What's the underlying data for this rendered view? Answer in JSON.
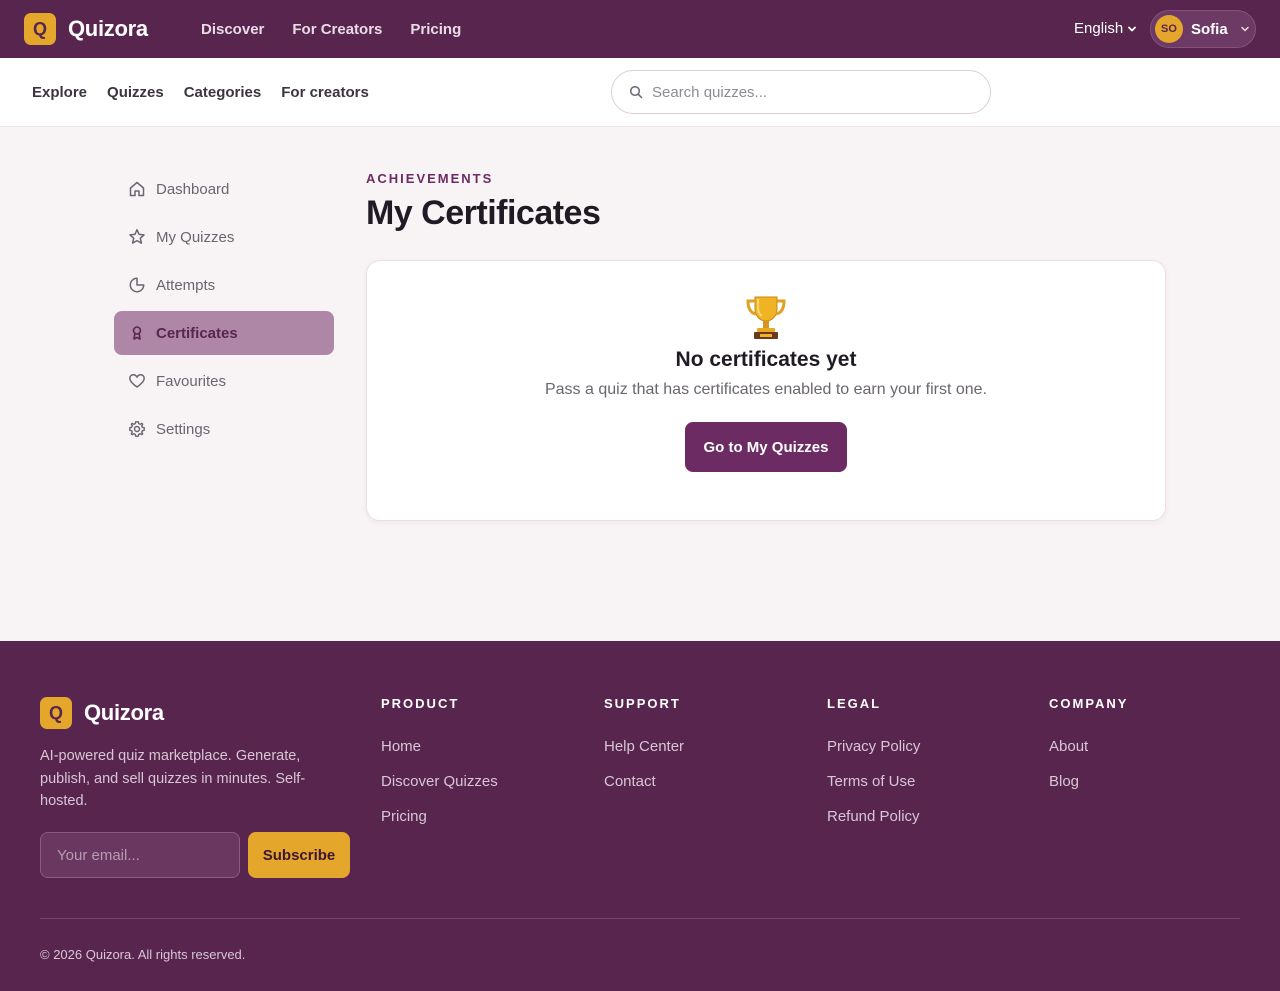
{
  "brand": {
    "logo_letter": "Q",
    "name": "Quizora"
  },
  "topnav": {
    "items": [
      "Discover",
      "For Creators",
      "Pricing"
    ]
  },
  "language": {
    "label": "English"
  },
  "user": {
    "initials": "SO",
    "name": "Sofia"
  },
  "subnav": {
    "items": [
      "Explore",
      "Quizzes",
      "Categories",
      "For creators"
    ]
  },
  "search": {
    "placeholder": "Search quizzes..."
  },
  "sidebar": {
    "items": [
      {
        "label": "Dashboard",
        "icon": "home-icon"
      },
      {
        "label": "My Quizzes",
        "icon": "star-icon"
      },
      {
        "label": "Attempts",
        "icon": "pie-icon"
      },
      {
        "label": "Certificates",
        "icon": "badge-icon",
        "active": true
      },
      {
        "label": "Favourites",
        "icon": "heart-icon"
      },
      {
        "label": "Settings",
        "icon": "gear-icon"
      }
    ]
  },
  "main": {
    "eyebrow": "ACHIEVEMENTS",
    "title": "My Certificates",
    "empty": {
      "icon": "🏆",
      "title": "No certificates yet",
      "text": "Pass a quiz that has certificates enabled to earn your first one.",
      "cta": "Go to My Quizzes"
    }
  },
  "footer": {
    "description": "AI-powered quiz marketplace. Generate, publish, and sell quizzes in minutes. Self-hosted.",
    "email_placeholder": "Your email...",
    "subscribe": "Subscribe",
    "columns": [
      {
        "title": "PRODUCT",
        "links": [
          "Home",
          "Discover Quizzes",
          "Pricing"
        ]
      },
      {
        "title": "SUPPORT",
        "links": [
          "Help Center",
          "Contact"
        ]
      },
      {
        "title": "LEGAL",
        "links": [
          "Privacy Policy",
          "Terms of Use",
          "Refund Policy"
        ]
      },
      {
        "title": "COMPANY",
        "links": [
          "About",
          "Blog"
        ]
      }
    ],
    "copyright": "© 2026 Quizora. All rights reserved."
  },
  "colors": {
    "brand_purple": "#58254f",
    "accent_gold": "#e5a62c",
    "active_item": "#ae87a7",
    "button": "#6d2b63"
  }
}
